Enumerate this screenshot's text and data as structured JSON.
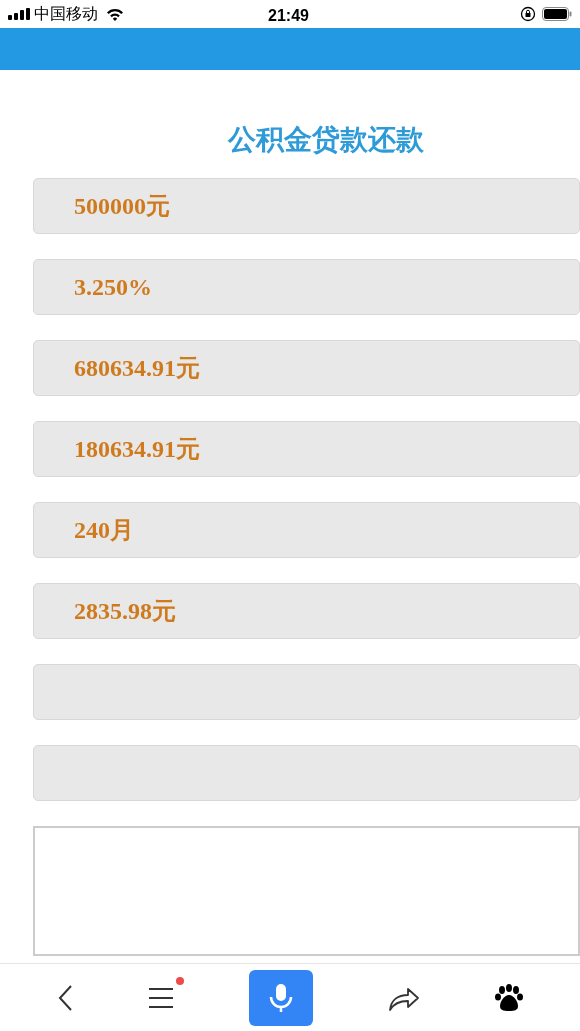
{
  "status_bar": {
    "carrier": "中国移动",
    "time": "21:49"
  },
  "title": "公积金贷款还款",
  "fields": [
    {
      "kind": "filled",
      "value": "500000元"
    },
    {
      "kind": "filled",
      "value": "3.250%"
    },
    {
      "kind": "filled",
      "value": "680634.91元"
    },
    {
      "kind": "filled",
      "value": "180634.91元"
    },
    {
      "kind": "filled",
      "value": "240月"
    },
    {
      "kind": "filled",
      "value": "2835.98元"
    },
    {
      "kind": "empty"
    },
    {
      "kind": "empty"
    }
  ],
  "bottom_bar": {
    "menu_badge": true
  }
}
